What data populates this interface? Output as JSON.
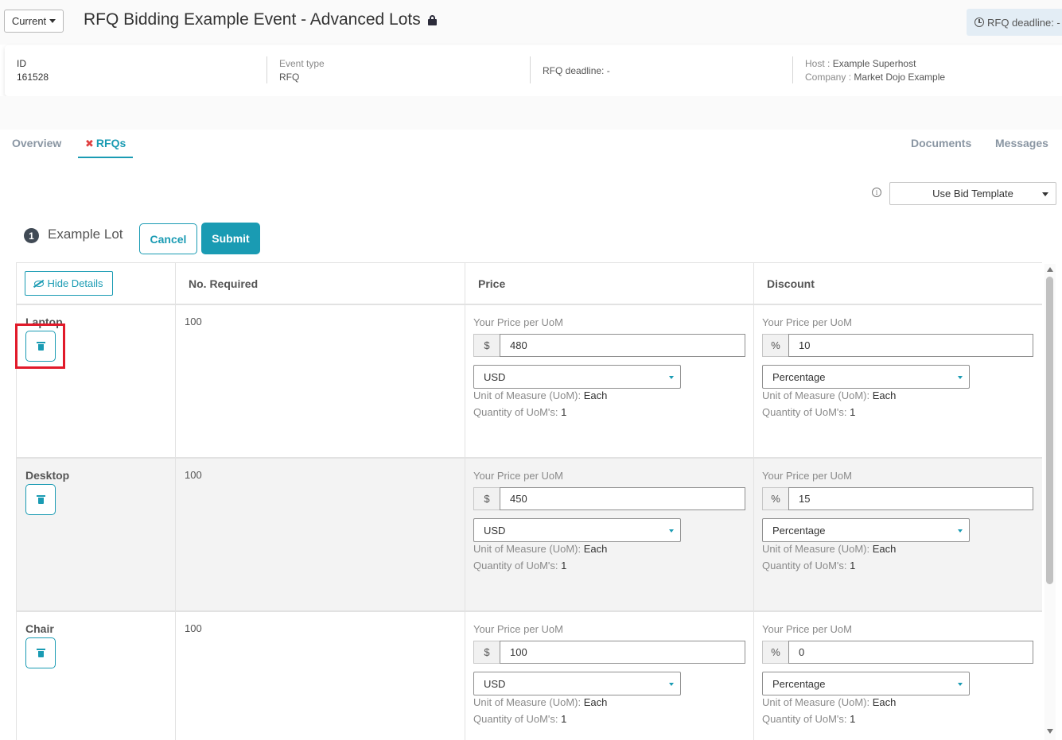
{
  "header": {
    "version_label": "Current",
    "event_title": "RFQ Bidding Example Event - Advanced Lots",
    "deadline_pill": "RFQ deadline: -"
  },
  "info": {
    "id_label": "ID",
    "id_value": "161528",
    "event_type_label": "Event type",
    "event_type_value": "RFQ",
    "deadline": "RFQ deadline: -",
    "host_label": "Host : ",
    "host_value": "Example Superhost",
    "company_label": "Company : ",
    "company_value": "Market Dojo Example"
  },
  "tabs": {
    "overview": "Overview",
    "rfqs": "RFQs",
    "documents": "Documents",
    "messages": "Messages"
  },
  "bid_template": {
    "info_glyph": "i",
    "label": "Use Bid Template"
  },
  "lot": {
    "number": "1",
    "name": "Example Lot",
    "cancel_label": "Cancel",
    "submit_label": "Submit"
  },
  "table": {
    "hide_details_label": "Hide Details",
    "col_required": "No. Required",
    "col_price": "Price",
    "col_discount": "Discount",
    "field_label": "Your Price per UoM",
    "uom_label": "Unit of Measure (UoM): ",
    "qty_uom_label": "Quantity of UoM's: ",
    "currency_symbol": "$",
    "percent_symbol": "%",
    "rows": [
      {
        "name": "Laptop",
        "required": "100",
        "price": "480",
        "currency": "USD",
        "discount": "10",
        "discount_type": "Percentage",
        "uom": "Each",
        "uom_qty": "1"
      },
      {
        "name": "Desktop",
        "required": "100",
        "price": "450",
        "currency": "USD",
        "discount": "15",
        "discount_type": "Percentage",
        "uom": "Each",
        "uom_qty": "1"
      },
      {
        "name": "Chair",
        "required": "100",
        "price": "100",
        "currency": "USD",
        "discount": "0",
        "discount_type": "Percentage",
        "uom": "Each",
        "uom_qty": "1"
      }
    ]
  },
  "colors": {
    "accent": "#1a9bb3",
    "highlight": "#e11a2a",
    "tab_inactive": "#8a96a3"
  },
  "icons": [
    "caret-down-icon",
    "lock-icon",
    "clock-icon",
    "close-icon",
    "info-icon",
    "eye-slash-icon",
    "trash-icon"
  ]
}
